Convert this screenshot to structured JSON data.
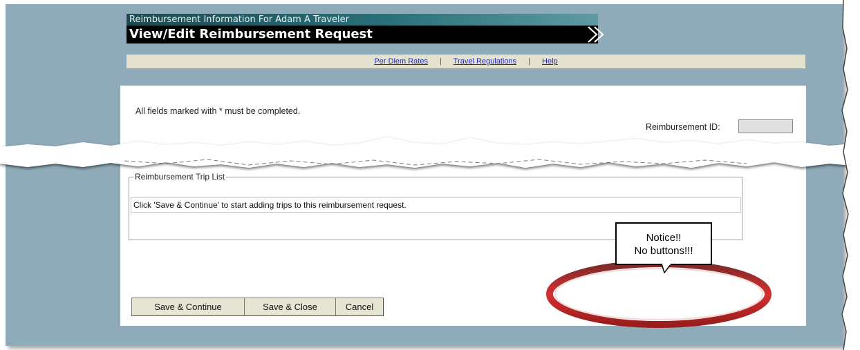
{
  "header": {
    "subtitle": "Reimbursement Information For Adam A Traveler",
    "title": "View/Edit Reimbursement Request"
  },
  "links": {
    "per_diem": "Per Diem Rates",
    "travel_regs": "Travel Regulations",
    "help": "Help",
    "separator": "|"
  },
  "form": {
    "required_note": "All fields marked with * must be completed.",
    "reimbursement_id_label": "Reimbursement ID:",
    "reimbursement_id_value": ""
  },
  "trip_list": {
    "legend": "Reimbursement Trip List",
    "message": "Click 'Save & Continue' to start adding trips to this reimbursement request."
  },
  "buttons": {
    "save_continue": "Save & Continue",
    "save_close": "Save & Close",
    "cancel": "Cancel"
  },
  "callout": {
    "line1": "Notice!!",
    "line2": "No buttons!!!"
  },
  "colors": {
    "frame_bg": "#8faab9",
    "link_color": "#1d27b4",
    "ellipse_red": "#b81a1a"
  }
}
